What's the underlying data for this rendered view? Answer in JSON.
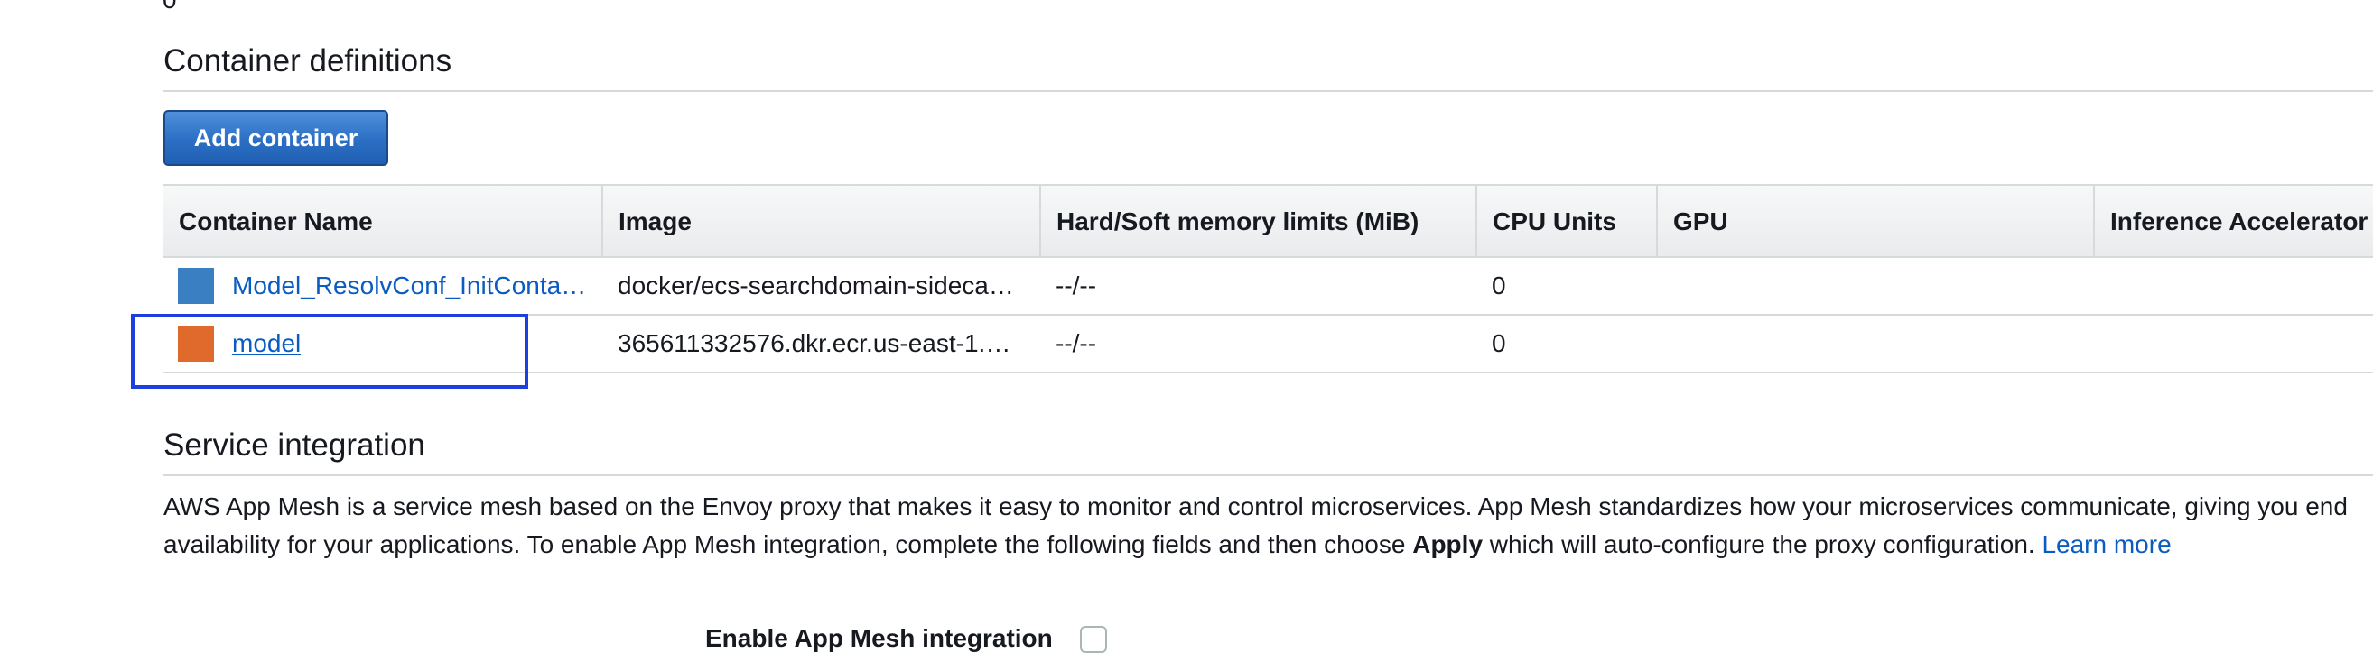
{
  "top_value": "0",
  "container_definitions": {
    "title": "Container definitions",
    "add_button_label": "Add container",
    "columns": [
      "Container Name",
      "Image",
      "Hard/Soft memory limits (MiB)",
      "CPU Units",
      "GPU",
      "Inference Accelerator"
    ],
    "rows": [
      {
        "name": "Model_ResolvConf_InitConta…",
        "image": "docker/ecs-searchdomain-sideca…",
        "memory": "--/--",
        "cpu": "0",
        "gpu": "",
        "inference": "",
        "swatch_color": "#3a7fc1"
      },
      {
        "name": "model",
        "image": "365611332576.dkr.ecr.us-east-1.…",
        "memory": "--/--",
        "cpu": "0",
        "gpu": "",
        "inference": "",
        "swatch_color": "#e06a2b"
      }
    ]
  },
  "service_integration": {
    "title": "Service integration",
    "description_line1": "AWS App Mesh is a service mesh based on the Envoy proxy that makes it easy to monitor and control microservices. App Mesh standardizes how your microservices communicate, giving you end",
    "description_line2_before": "availability for your applications. To enable App Mesh integration, complete the following fields and then choose ",
    "description_line2_bold": "Apply",
    "description_line2_after": " which will auto-configure the proxy configuration. ",
    "learn_more": "Learn more",
    "enable_label": "Enable App Mesh integration",
    "enable_checked": false
  },
  "colors": {
    "link": "#0a5cc2",
    "primary_button": "#2b6fc4",
    "highlight_border": "#1d3fe0"
  }
}
